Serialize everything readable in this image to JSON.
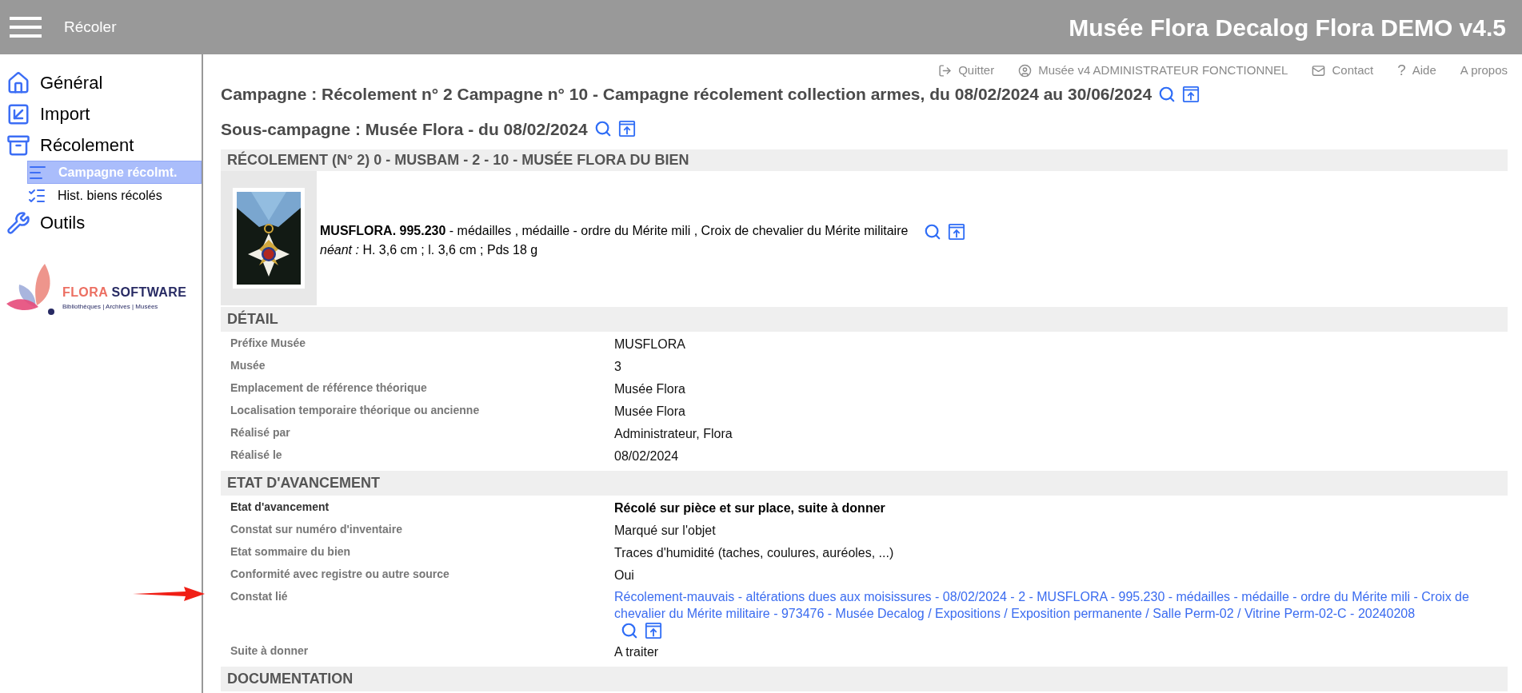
{
  "topbar": {
    "section": "Récoler",
    "app_title": "Musée Flora Decalog Flora DEMO v4.5"
  },
  "sidebar": {
    "items": [
      {
        "label": "Général",
        "selected": false
      },
      {
        "label": "Import",
        "selected": false
      },
      {
        "label": "Récolement",
        "selected": false,
        "children": [
          {
            "label": "Campagne récolmt.",
            "selected": true
          },
          {
            "label": "Hist. biens récolés",
            "selected": false
          }
        ]
      },
      {
        "label": "Outils",
        "selected": false
      }
    ],
    "logo": {
      "brand_first": "FLORA",
      "brand_second": "SOFTWARE",
      "tagline": "Bibliothèques | Archives | Musées"
    }
  },
  "user_links": [
    {
      "label": "Quitter"
    },
    {
      "label": "Musée v4 ADMINISTRATEUR FONCTIONNEL"
    },
    {
      "label": "Contact"
    },
    {
      "label": "Aide",
      "glyph": "?"
    },
    {
      "label": "A propos"
    }
  ],
  "campaign_title": "Campagne : Récolement n° 2 Campagne n° 10 - Campagne récolement collection armes, du 08/02/2024 au 30/06/2024",
  "subcampaign_title": "Sous-campagne : Musée Flora - du 08/02/2024",
  "record": {
    "header": "RÉCOLEMENT (N° 2) 0 - MUSBAM - 2 - 10 - MUSÉE FLORA DU BIEN",
    "object": {
      "kind": "picture",
      "description": "**MUSFLORA. 995.230** - médailles , médaille - ordre du Mérite mili , Croix de chevalier du Mérite militaire",
      "dimensions": "*néant :* H. 3,6 cm ; l. 3,6 cm ; Pds 18  g"
    }
  },
  "sections": [
    {
      "title": "DÉTAIL",
      "rows": [
        {
          "kind": "normal",
          "label": "Préfixe Musée",
          "value": "MUSFLORA"
        },
        {
          "kind": "normal",
          "label": "Musée",
          "value": "3"
        },
        {
          "kind": "normal",
          "label": "Emplacement de référence théorique",
          "value": "Musée Flora"
        },
        {
          "kind": "normal",
          "label": "Localisation temporaire théorique ou ancienne",
          "value": "Musée Flora"
        },
        {
          "kind": "normal",
          "label": "Réalisé par",
          "value": "Administrateur, Flora"
        },
        {
          "kind": "normal",
          "label": "Réalisé le",
          "value": "08/02/2024"
        }
      ]
    },
    {
      "title": "ETAT D'AVANCEMENT",
      "rows": [
        {
          "kind": "strong",
          "label": "Etat d'avancement",
          "value": "Récolé sur pièce et sur place, suite à donner"
        },
        {
          "kind": "normal",
          "label": "Constat sur numéro d'inventaire",
          "value": "Marqué sur l'objet"
        },
        {
          "kind": "normal",
          "label": "Etat sommaire du bien",
          "value": "Traces d'humidité (taches, coulures, auréoles, ...)"
        },
        {
          "kind": "normal",
          "label": "Conformité avec registre ou autre source",
          "value": "Oui"
        },
        {
          "kind": "link",
          "label": "Constat lié",
          "value": "Récolement-mauvais - altérations dues aux moisissures - 08/02/2024 - 2 - MUSFLORA - 995.230 - médailles - médaille - ordre du Mérite mili - Croix de chevalier du Mérite militaire - 973476 - Musée Decalog / Expositions / Exposition permanente / Salle Perm-02 / Vitrine Perm-02-C - 20240208",
          "pointer": true
        },
        {
          "kind": "normal",
          "label": "Suite à donner",
          "value": "A traiter"
        }
      ]
    },
    {
      "title": "DOCUMENTATION"
    }
  ]
}
